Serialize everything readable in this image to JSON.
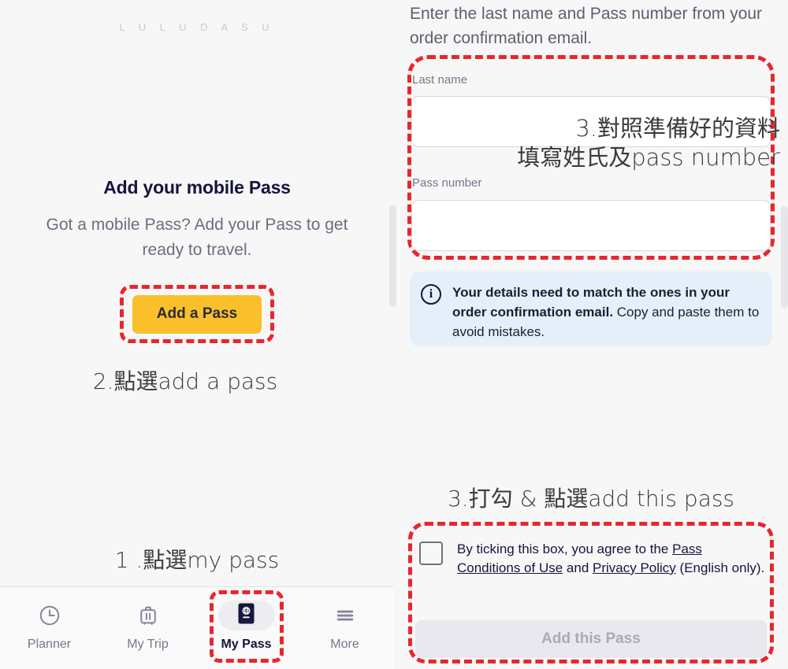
{
  "watermark": "L U L U D A S U",
  "left_panel": {
    "title": "Add your mobile Pass",
    "subtitle": "Got a mobile Pass? Add your Pass to get ready to travel.",
    "add_pass_button": "Add a Pass",
    "annotation_step2": "2.點選add a pass",
    "annotation_step1": "1 .點選my pass",
    "nav": {
      "items": [
        {
          "label": "Planner",
          "icon": "clock-icon",
          "active": false
        },
        {
          "label": "My Trip",
          "icon": "suitcase-icon",
          "active": false
        },
        {
          "label": "My Pass",
          "icon": "passport-icon",
          "active": true
        },
        {
          "label": "More",
          "icon": "hamburger-icon",
          "active": false
        }
      ]
    }
  },
  "right_panel": {
    "heading": "Enter the last name and Pass number from your order confirmation email.",
    "last_name_label": "Last name",
    "last_name_value": "",
    "last_name_placeholder": "",
    "pass_number_label": "Pass number",
    "pass_number_value": "",
    "pass_number_placeholder": "",
    "annotation_fill_line1": "3.對照準備好的資料",
    "annotation_fill_line2": "填寫姓氏及pass number",
    "info_icon": "info-circle-icon",
    "info_bold": "Your details need to match the ones in your order confirmation email.",
    "info_rest": " Copy and paste them to avoid mistakes.",
    "annotation_step3": "3.打勾 & 點選add this pass",
    "consent": {
      "prefix": "By ticking this box, you agree to the ",
      "link1": "Pass Conditions of Use",
      "middle": " and ",
      "link2": "Privacy Policy",
      "suffix": " (English only)."
    },
    "add_this_pass_button": "Add this Pass"
  },
  "colors": {
    "accent_yellow": "#f9c02c",
    "annotation_red": "#e8262d",
    "brand_navy": "#15153d",
    "info_bg": "#e4eff9",
    "panel_bg": "#f7f7f7",
    "disabled_button": "#e8e8ee"
  }
}
